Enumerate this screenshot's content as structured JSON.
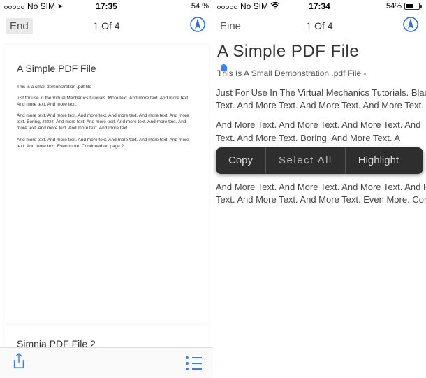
{
  "left": {
    "status": {
      "carrier": "No SIM",
      "time": "17:35",
      "battery_pct": "54 %",
      "battery_fill": 54
    },
    "nav": {
      "title": "End",
      "page": "1 Of 4"
    },
    "doc": {
      "title": "A Simple PDF File",
      "p1": "This is a small demonstration .pdf file -",
      "p2": "just for use in the Virtual Mechanics tutorials. More text. And more text. And more text. And more text. And more text.",
      "p3": "And more text. And more text. And more text. And more text. And more text. And more text. Boring, zzzzz. And more text. And more text. And more text. And more text. And more text. And more text. And more text. And more text.",
      "p4": "And more text. And more text. And more text. And more text. And more text. And more text. And more text. Even more. Continued on page 2 ..."
    },
    "doc2_title": "Simnia PDF File 2"
  },
  "right": {
    "status": {
      "carrier": "No SIM",
      "time": "17:34",
      "battery_pct": "54%",
      "battery_fill": 54
    },
    "nav": {
      "title": "Eine",
      "page": "1 Of 4"
    },
    "zoom_title": "A Simple PDF File",
    "sel_line": "This Is A Small Demonstration .pdf File -",
    "p1a": "Just For Use In The Virtual Mechanics Tutorials. BlackBerry",
    "p1b": "Text. And More Text. And More Text. And More Text.",
    "p2a": "And More Text. And More Text. And More Text. And",
    "p2b": "Text. And More Text. Boring. And More Text. A",
    "p3a": "And More Text. And More Text. And More Text. And R",
    "p3b": "Text. And More Text. And More Text. Even More. Cor",
    "popup": {
      "copy": "Copy",
      "select_all": "Select All",
      "highlight": "Highlight"
    }
  }
}
